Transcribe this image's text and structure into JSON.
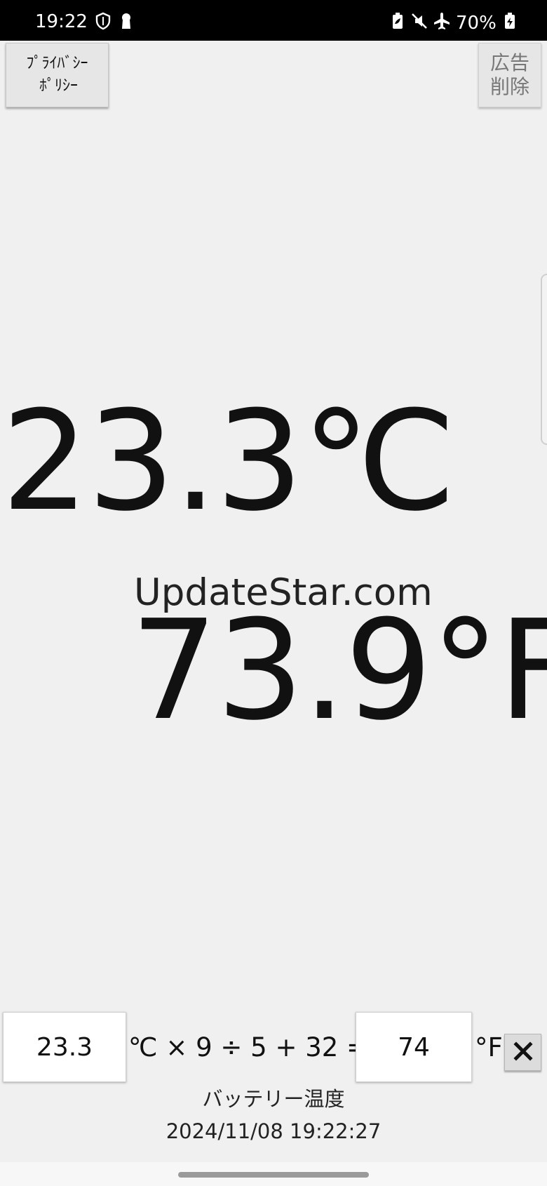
{
  "status_bar": {
    "time": "19:22",
    "battery_percent": "70%",
    "icons_left": [
      "shield-icon",
      "keyhole-icon"
    ],
    "icons_right": [
      "battery-saver-icon",
      "mute-icon",
      "airplane-mode-icon",
      "battery-charging-icon"
    ]
  },
  "toolbar": {
    "privacy_line1": "ﾌﾟﾗｲﾊﾞｼｰ",
    "privacy_line2": "ﾎﾟﾘｼｰ",
    "remove_ads_line1": "広告",
    "remove_ads_line2": "削除"
  },
  "display": {
    "celsius": "23.3℃",
    "watermark": "UpdateStar.com",
    "fahrenheit": "73.9°F"
  },
  "converter": {
    "celsius_value": "23.3",
    "formula": "℃ × 9 ÷ 5 + 32 =",
    "fahrenheit_value": "74",
    "fahrenheit_unit": "°F",
    "clear_icon": "close-icon"
  },
  "footer": {
    "caption": "バッテリー温度",
    "timestamp": "2024/11/08 19:22:27"
  },
  "colors": {
    "background": "#f0f0f0",
    "status_bar": "#000000",
    "text": "#111111"
  }
}
